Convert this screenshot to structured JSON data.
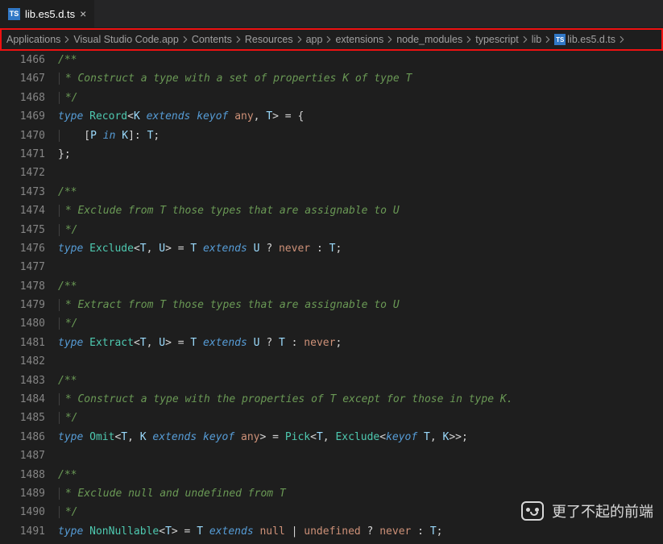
{
  "tab": {
    "icon": "TS",
    "filename": "lib.es5.d.ts"
  },
  "breadcrumbs": [
    "Applications",
    "Visual Studio Code.app",
    "Contents",
    "Resources",
    "app",
    "extensions",
    "node_modules",
    "typescript",
    "lib"
  ],
  "breadcrumb_file": {
    "icon": "TS",
    "name": "lib.es5.d.ts"
  },
  "line_numbers": [
    "1466",
    "1467",
    "1468",
    "1469",
    "1470",
    "1471",
    "1472",
    "1473",
    "1474",
    "1475",
    "1476",
    "1477",
    "1478",
    "1479",
    "1480",
    "1481",
    "1482",
    "1483",
    "1484",
    "1485",
    "1486",
    "1487",
    "1488",
    "1489",
    "1490",
    "1491"
  ],
  "highlight_line_index": 6,
  "code": {
    "l1466": "/**",
    "l1467": " * Construct a type with a set of properties K of type T",
    "l1468": " */",
    "l1469": {
      "kw": "type",
      "sp1": " ",
      "name": "Record",
      "lt": "<",
      "p1": "K",
      "sp2": " ",
      "ext": "extends",
      "sp3": " ",
      "kof": "keyof",
      "sp4": " ",
      "any": "any",
      "comma": ", ",
      "p2": "T",
      "gt": ">",
      "eq": " = {"
    },
    "l1470": {
      "indent": "    [",
      "p": "P",
      "sp": " ",
      "in": "in",
      "sp2": " ",
      "k": "K",
      "close": "]: ",
      "t": "T",
      "semi": ";"
    },
    "l1471": "};",
    "l1472": "",
    "l1473": "/**",
    "l1474": " * Exclude from T those types that are assignable to U",
    "l1475": " */",
    "l1476": {
      "kw": "type",
      "sp1": " ",
      "name": "Exclude",
      "lt": "<",
      "p1": "T",
      "comma": ", ",
      "p2": "U",
      "gt": ">",
      "eq": " = ",
      "t": "T",
      "sp2": " ",
      "ext": "extends",
      "sp3": " ",
      "u": "U",
      "q": " ? ",
      "nv": "never",
      "colon": " : ",
      "t2": "T",
      "semi": ";"
    },
    "l1477": "",
    "l1478": "/**",
    "l1479": " * Extract from T those types that are assignable to U",
    "l1480": " */",
    "l1481": {
      "kw": "type",
      "sp1": " ",
      "name": "Extract",
      "lt": "<",
      "p1": "T",
      "comma": ", ",
      "p2": "U",
      "gt": ">",
      "eq": " = ",
      "t": "T",
      "sp2": " ",
      "ext": "extends",
      "sp3": " ",
      "u": "U",
      "q": " ? ",
      "t2": "T",
      "colon": " : ",
      "nv": "never",
      "semi": ";"
    },
    "l1482": "",
    "l1483": "/**",
    "l1484": " * Construct a type with the properties of T except for those in type K.",
    "l1485": " */",
    "l1486": {
      "kw": "type",
      "sp1": " ",
      "name": "Omit",
      "lt": "<",
      "p1": "T",
      "comma": ", ",
      "p2": "K",
      "sp2": " ",
      "ext": "extends",
      "sp3": " ",
      "kof": "keyof",
      "sp4": " ",
      "any": "any",
      "gt": ">",
      "eq": " = ",
      "pick": "Pick",
      "lt2": "<",
      "t": "T",
      "comma2": ", ",
      "excl": "Exclude",
      "lt3": "<",
      "kof2": "keyof",
      "sp5": " ",
      "t2": "T",
      "comma3": ", ",
      "k": "K",
      "gt2": ">>;"
    },
    "l1487": "",
    "l1488": "/**",
    "l1489": " * Exclude null and undefined from T",
    "l1490": " */",
    "l1491": {
      "kw": "type",
      "sp1": " ",
      "name": "NonNullable",
      "lt": "<",
      "p1": "T",
      "gt": ">",
      "eq": " = ",
      "t": "T",
      "sp2": " ",
      "ext": "extends",
      "sp3": " ",
      "null": "null",
      "pipe": " | ",
      "undef": "undefined",
      "q": " ? ",
      "nv": "never",
      "colon": " : ",
      "t2": "T",
      "semi": ";"
    }
  },
  "watermark_text": "更了不起的前端"
}
